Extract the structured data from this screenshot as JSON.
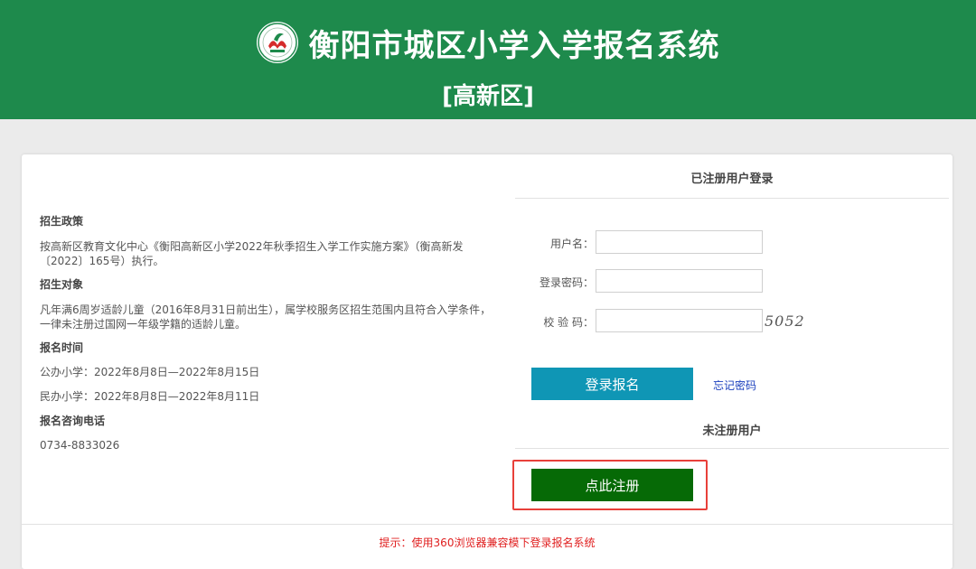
{
  "header": {
    "title": "衡阳市城区小学入学报名系统",
    "district": "[高新区]",
    "logo_icon": "school-emblem-icon",
    "bg_color": "#1e8a4c"
  },
  "policy": {
    "h1": "招生政策",
    "p1": "按高新区教育文化中心《衡阳高新区小学2022年秋季招生入学工作实施方案》（衡高新发〔2022〕165号）执行。",
    "h2": "招生对象",
    "p2": "凡年满6周岁适龄儿童（2016年8月31日前出生），属学校服务区招生范围内且符合入学条件，一律未注册过国网一年级学籍的适龄儿童。",
    "h3": "报名时间",
    "p3a": "公办小学：2022年8月8日—2022年8月15日",
    "p3b": "民办小学：2022年8月8日—2022年8月11日",
    "h4": "报名咨询电话",
    "p4": "0734-8833026"
  },
  "login": {
    "title": "已注册用户登录",
    "username_label": "用户名：",
    "username_value": "",
    "password_label": "登录密码：",
    "password_value": "",
    "captcha_label": "校 验 码：",
    "captcha_value": "",
    "captcha_text": "5052",
    "login_button": "登录报名",
    "forgot_link": "忘记密码"
  },
  "register": {
    "title": "未注册用户",
    "button": "点此注册"
  },
  "footer": {
    "tip": "提示：使用360浏览器兼容模下登录报名系统"
  },
  "colors": {
    "login_button": "#0f96b5",
    "register_button": "#066a06",
    "highlight_box": "#e8403a",
    "tip_text": "#e02020"
  }
}
